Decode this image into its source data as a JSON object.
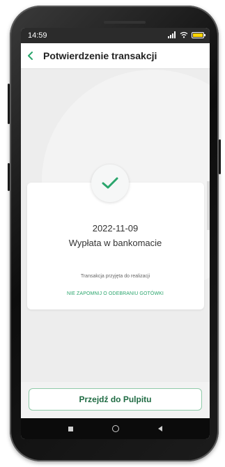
{
  "status_bar": {
    "time": "14:59"
  },
  "header": {
    "back_icon": "chevron-left-icon",
    "title": "Potwierdzenie transakcji"
  },
  "confirmation": {
    "icon": "checkmark-icon",
    "date": "2022-11-09",
    "operation": "Wypłata w bankomacie",
    "status": "Transakcja przyjęta do realizacji",
    "reminder": "NIE ZAPOMNIJ O ODEBRANIU GOTÓWKI"
  },
  "actions": {
    "primary_label": "Przejdź do Pulpitu"
  },
  "colors": {
    "accent": "#2aa56c",
    "primary_text": "#1f6b43",
    "status_bar_bg": "#2b2b2b"
  }
}
